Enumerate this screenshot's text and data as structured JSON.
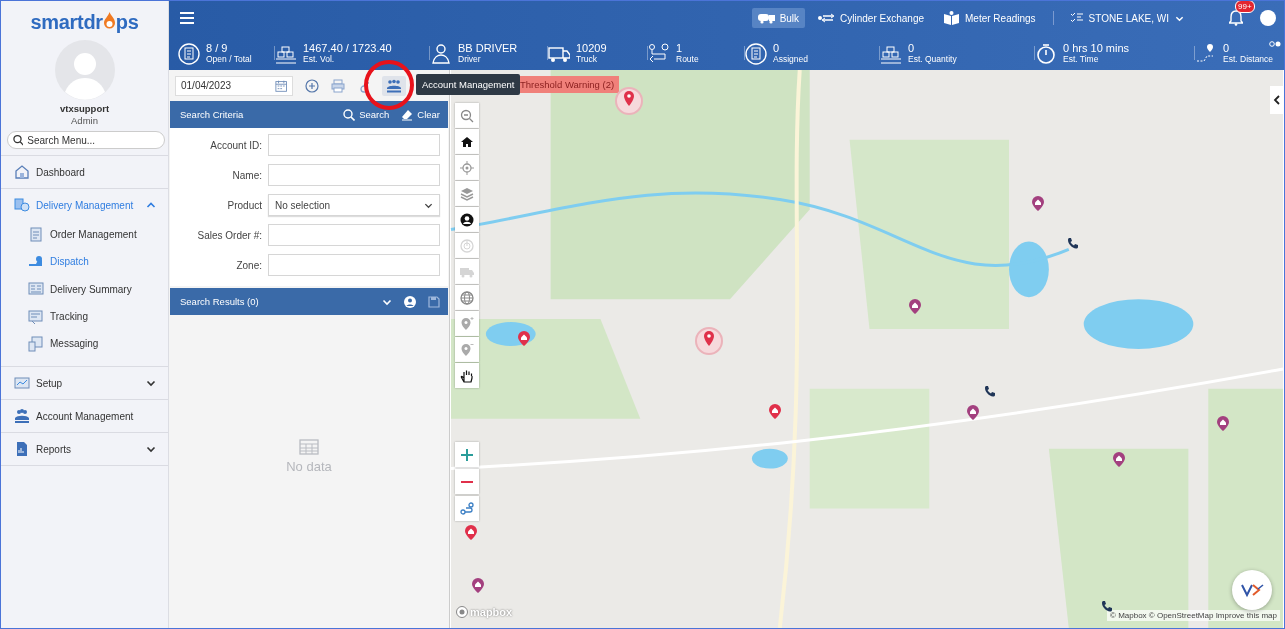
{
  "sidebar": {
    "logo": {
      "before": "smartdr",
      "after": "ps"
    },
    "user": {
      "name": "vtxsupport",
      "role": "Admin"
    },
    "search": {
      "placeholder": "Search Menu..."
    },
    "menu": [
      {
        "label": "Dashboard",
        "selected": false
      },
      {
        "label": "Delivery Management",
        "selected": true,
        "expanded": true,
        "children": [
          {
            "label": "Order Management",
            "selected": false
          },
          {
            "label": "Dispatch",
            "selected": true
          },
          {
            "label": "Delivery Summary",
            "selected": false
          },
          {
            "label": "Tracking",
            "selected": false
          },
          {
            "label": "Messaging",
            "selected": false
          }
        ]
      },
      {
        "label": "Setup",
        "selected": false,
        "expanded": false
      },
      {
        "label": "Account Management",
        "selected": false
      },
      {
        "label": "Reports",
        "selected": false,
        "expanded": false
      }
    ]
  },
  "topbar": {
    "modes": [
      {
        "label": "Bulk",
        "selected": true
      },
      {
        "label": "Cylinder Exchange",
        "selected": false
      },
      {
        "label": "Meter Readings",
        "selected": false
      }
    ],
    "location": "STONE LAKE, WI",
    "notifications": "99+"
  },
  "stats": [
    {
      "value": "8 / 9",
      "label": "Open / Total"
    },
    {
      "value": "1467.40 / 1723.40",
      "label": "Est. Vol."
    },
    {
      "value": "BB DRIVER",
      "label": "Driver"
    },
    {
      "value": "10209",
      "label": "Truck"
    },
    {
      "value": "1",
      "label": "Route"
    },
    {
      "value": "0",
      "label": "Assigned"
    },
    {
      "value": "0",
      "label": "Est. Quantity"
    },
    {
      "value": "0 hrs 10 mins",
      "label": "Est. Time"
    },
    {
      "value": "0",
      "label": "Est. Distance"
    }
  ],
  "toolbar": {
    "date": "01/04/2023",
    "tooltip": "Account Management",
    "warning": "Threshold Warning (2)"
  },
  "search_criteria": {
    "title": "Search Criteria",
    "search": "Search",
    "clear": "Clear",
    "fields": [
      {
        "kind": "text",
        "label": "Account ID:"
      },
      {
        "kind": "text",
        "label": "Name:"
      },
      {
        "kind": "select",
        "label": "Product",
        "value": "No selection"
      },
      {
        "kind": "text",
        "label": "Sales Order #:"
      },
      {
        "kind": "text",
        "label": "Zone:"
      }
    ]
  },
  "search_results": {
    "title": "Search Results (0)",
    "empty": "No data"
  },
  "map": {
    "kind": "picture",
    "controls": [
      {
        "disabled": false
      },
      {
        "disabled": false
      },
      {
        "disabled": false
      },
      {
        "disabled": false
      },
      {
        "disabled": false
      },
      {
        "disabled": true
      },
      {
        "disabled": true
      },
      {
        "disabled": false
      },
      {
        "disabled": false
      },
      {
        "disabled": false
      },
      {
        "disabled": false
      }
    ],
    "markers": [
      {
        "kind": "alert",
        "color": "#e0304a"
      },
      {
        "kind": "alert",
        "color": "#e0304a"
      },
      {
        "kind": "home",
        "color": "#e0304a"
      },
      {
        "kind": "home",
        "color": "#e0304a"
      },
      {
        "kind": "home",
        "color": "#e0304a"
      },
      {
        "kind": "home",
        "color": "#a3407f"
      },
      {
        "kind": "home",
        "color": "#a3407f"
      },
      {
        "kind": "home",
        "color": "#a3407f"
      },
      {
        "kind": "home",
        "color": "#a3407f"
      },
      {
        "kind": "home",
        "color": "#a3407f"
      },
      {
        "kind": "home",
        "color": "#a3407f"
      },
      {
        "kind": "phone",
        "color": "#1f3557"
      },
      {
        "kind": "phone",
        "color": "#1f3557"
      },
      {
        "kind": "phone",
        "color": "#1f3557"
      }
    ],
    "logo": "mapbox",
    "attribution": "© Mapbox © OpenStreetMap Improve this map"
  }
}
